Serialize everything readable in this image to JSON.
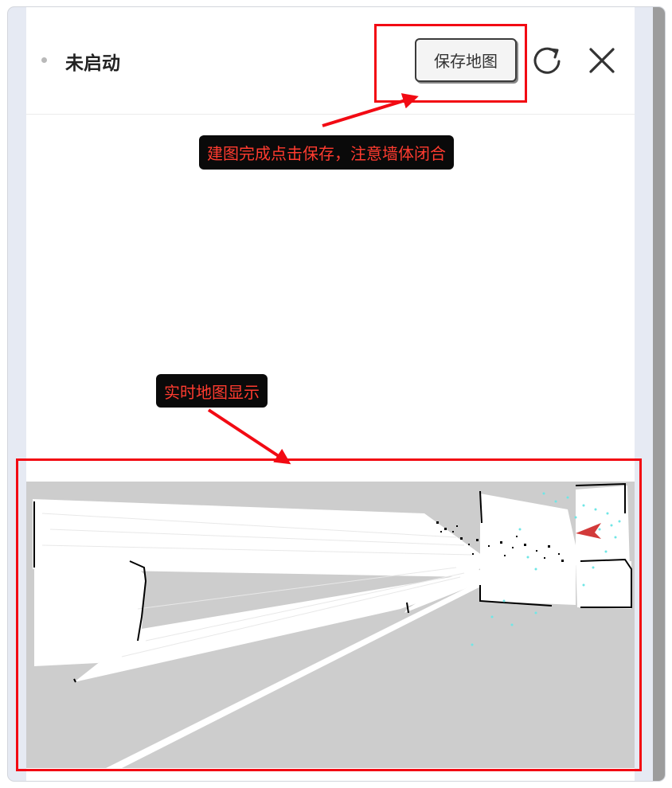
{
  "header": {
    "status": "未启动",
    "save_map_label": "保存地图"
  },
  "icons": {
    "status_dot": "dot-icon",
    "refresh": "refresh-icon",
    "close": "close-icon",
    "robot_marker": "robot-arrow-icon"
  },
  "annotations": {
    "save_tip": "建图完成点击保存，注意墙体闭合",
    "map_tip": "实时地图显示"
  },
  "colors": {
    "annotation_red": "#f20a13",
    "annotation_text": "#ff3b2f",
    "map_unknown": "#cdcdcd",
    "map_free": "#ffffff",
    "map_obstacle": "#000000",
    "laser_scan": "#6fe6e6",
    "robot": "#d23a3a"
  }
}
